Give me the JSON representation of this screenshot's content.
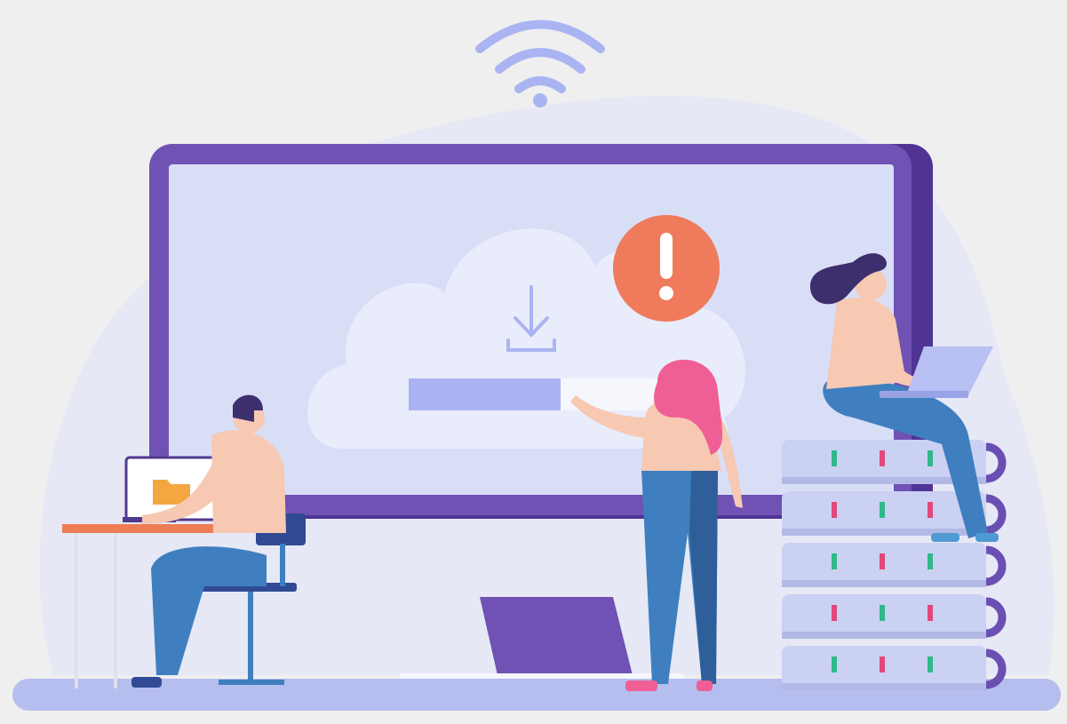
{
  "scene": {
    "description_label": "",
    "colors": {
      "background": "#efefef",
      "blob": "#e6e8f6",
      "monitor_frame": "#6f52b3",
      "monitor_frame_dark": "#4f3494",
      "screen": "#d9def7",
      "cloud": "#e9ecfb",
      "progress_fill": "#aab4f2",
      "progress_track": "#f6f7fd",
      "alert": "#ef7b5c",
      "alert_mark": "#ffffff",
      "skin": "#f7c8b2",
      "jeans": "#3f7fbf",
      "jeans_dark": "#2f5f9a",
      "hair_pink": "#ef5f96",
      "hair_dark": "#3d2f6d",
      "server": "#cbd1f2",
      "server_dark": "#b2b9e6",
      "server_ring": "#6a4fb3",
      "led_green": "#2fb889",
      "led_pink": "#e2487a",
      "desk_top": "#ee7c55",
      "folder": "#f4a640",
      "floor": "#b6bdef"
    },
    "progress": {
      "fill_fraction": 0.6
    },
    "icons": [
      "wifi-icon",
      "download-icon",
      "alert-icon",
      "folder-icon"
    ]
  }
}
